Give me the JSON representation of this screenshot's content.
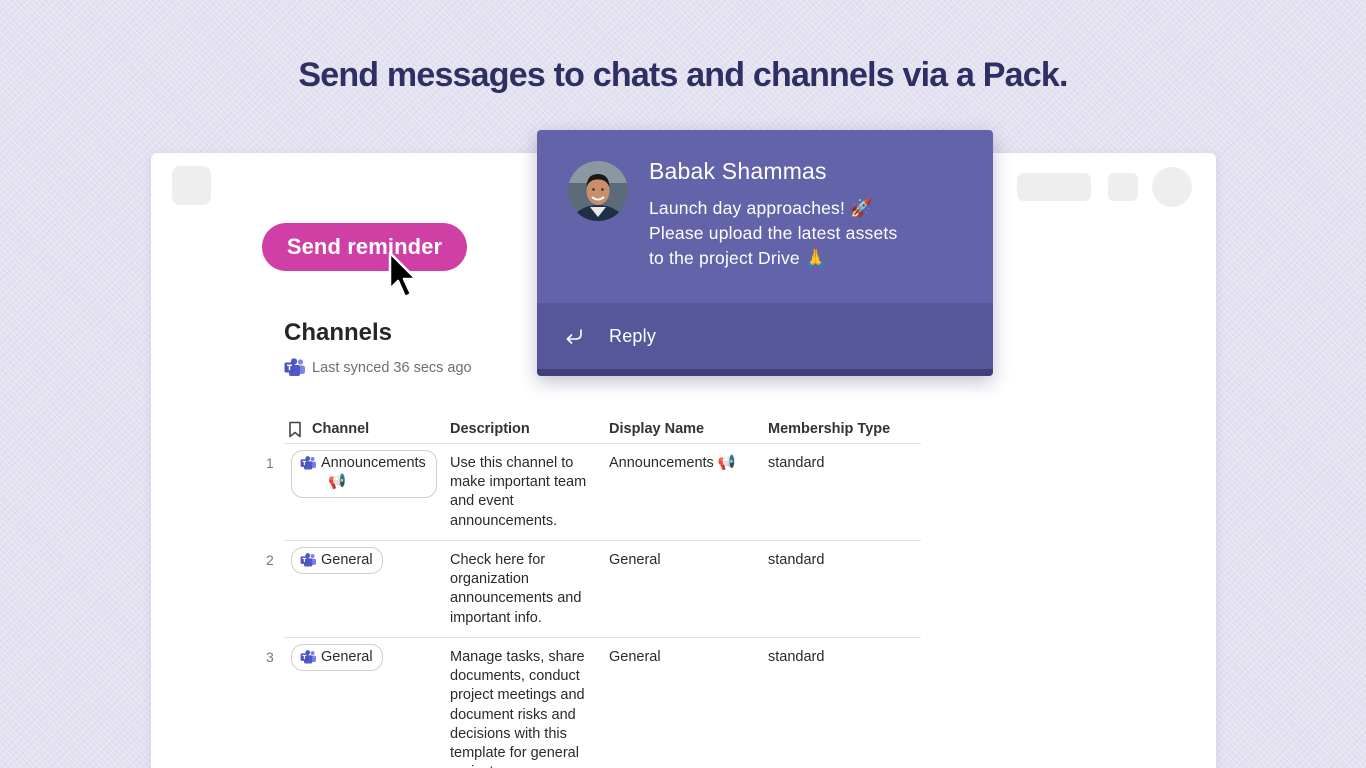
{
  "headline": "Send messages to chats and channels via a Pack.",
  "doc": {
    "send_button": "Send reminder",
    "section_title": "Channels",
    "sync_status": "Last synced 36 secs ago"
  },
  "table": {
    "headers": [
      "Channel",
      "Description",
      "Display Name",
      "Membership Type"
    ],
    "rows": [
      {
        "num": "1",
        "channel_line1": "Announcements",
        "channel_line2": "📢",
        "description": "Use this channel to make important team and event announcements.",
        "display_name": "Announcements 📢",
        "membership": "standard"
      },
      {
        "num": "2",
        "channel_line1": "General",
        "description": "Check here for organization announcements and important info.",
        "display_name": "General",
        "membership": "standard"
      },
      {
        "num": "3",
        "channel_line1": "General",
        "description": "Manage tasks, share documents, conduct project meetings and document risks and decisions with this template for general project",
        "display_name": "General",
        "membership": "standard"
      }
    ]
  },
  "notification": {
    "sender": "Babak Shammas",
    "message_line1": "Launch day approaches! 🚀",
    "message_line2": "Please upload the latest assets",
    "message_line3": "to the project Drive 🙏",
    "reply_label": "Reply"
  },
  "colors": {
    "accent": "#cf3fa5",
    "popup_bg": "#6263a8",
    "popup_footer": "#56579a",
    "headline": "#2e2f63",
    "teams": "#5059c9"
  }
}
